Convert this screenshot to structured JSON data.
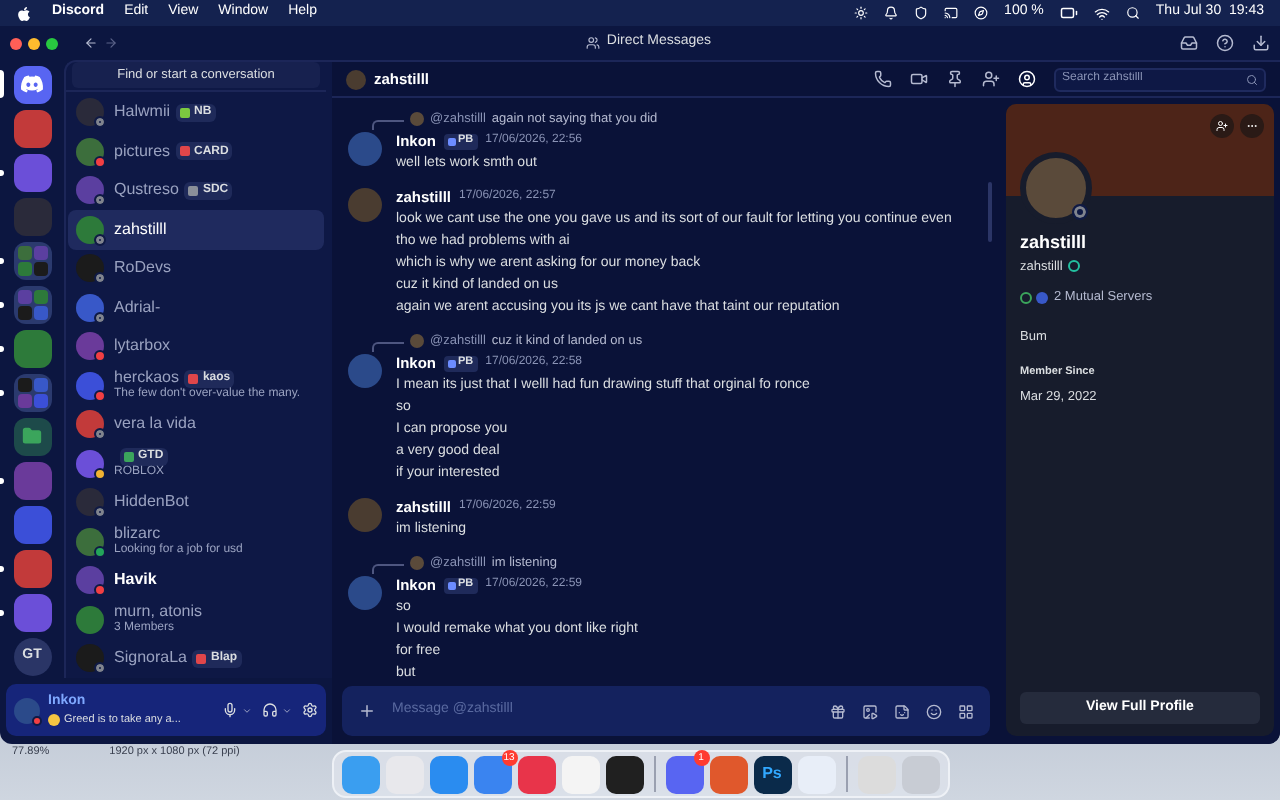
{
  "menu_bar": {
    "app": "Discord",
    "menus": [
      "Edit",
      "View",
      "Window",
      "Help"
    ],
    "battery": "100 %",
    "clock": "Thu Jul 30  19:43"
  },
  "window": {
    "title": "Direct Messages"
  },
  "servers": [
    {
      "kind": "home",
      "selected": true,
      "unread": false
    },
    {
      "kind": "image",
      "selected": false,
      "unread": false
    },
    {
      "kind": "image",
      "selected": false,
      "unread": true
    },
    {
      "kind": "image",
      "selected": false,
      "unread": false
    },
    {
      "kind": "folder",
      "selected": false,
      "unread": true
    },
    {
      "kind": "folder",
      "selected": false,
      "unread": true
    },
    {
      "kind": "image",
      "selected": false,
      "unread": true
    },
    {
      "kind": "folder",
      "selected": false,
      "unread": true
    },
    {
      "kind": "folder-open",
      "selected": false,
      "unread": false
    },
    {
      "kind": "image",
      "selected": false,
      "unread": true
    },
    {
      "kind": "image",
      "selected": false,
      "unread": false
    },
    {
      "kind": "image",
      "selected": false,
      "unread": true
    },
    {
      "kind": "image",
      "selected": false,
      "unread": true
    },
    {
      "kind": "text",
      "label": "GT",
      "selected": false,
      "unread": false
    }
  ],
  "dm_search": {
    "label": "Find or start a conversation"
  },
  "dms": [
    {
      "name": "Halwmii",
      "badge": {
        "text": "NB",
        "color": "#7cc940"
      },
      "status": {
        "color": "#80848e",
        "hollow": true
      },
      "selected": false,
      "unread": false
    },
    {
      "name": "pictures",
      "badge": {
        "text": "CARD",
        "color": "#e0464a"
      },
      "status": {
        "color": "#f23f43",
        "hollow": false
      },
      "selected": false,
      "unread": false
    },
    {
      "name": "Qustreso",
      "badge": {
        "text": "SDC",
        "color": "#8a8f99"
      },
      "status": {
        "color": "#80848e",
        "hollow": true
      },
      "selected": false,
      "unread": false
    },
    {
      "name": "zahstilll",
      "status": {
        "color": "#80848e",
        "hollow": true
      },
      "selected": true,
      "unread": false
    },
    {
      "name": "RoDevs",
      "status": {
        "color": "#80848e",
        "hollow": true
      },
      "selected": false,
      "unread": false
    },
    {
      "name": "Adrial-",
      "status": {
        "color": "#80848e",
        "hollow": true
      },
      "selected": false,
      "unread": false
    },
    {
      "name": "lytarbox",
      "status": {
        "color": "#f23f43",
        "hollow": false
      },
      "selected": false,
      "unread": false
    },
    {
      "name": "herckaos",
      "badge": {
        "text": "kaos",
        "color": "#e0464a"
      },
      "subtitle": "The few don't over-value the many.",
      "status": {
        "color": "#f23f43",
        "hollow": false
      },
      "selected": false,
      "unread": false
    },
    {
      "name": "vera la vida",
      "status": {
        "color": "#80848e",
        "hollow": true
      },
      "selected": false,
      "unread": false
    },
    {
      "badge": {
        "text": "GTD",
        "color": "#3ba55c"
      },
      "subtitle": "ROBLOX",
      "status": {
        "color": "#f0b232",
        "hollow": false
      },
      "selected": false,
      "unread": false
    },
    {
      "name": "HiddenBot",
      "status": {
        "color": "#80848e",
        "hollow": true
      },
      "selected": false,
      "unread": false
    },
    {
      "name": "blizarc",
      "subtitle": "Looking for a job for usd",
      "status": {
        "color": "#23a55a",
        "hollow": false
      },
      "selected": false,
      "unread": false
    },
    {
      "name": "Havik",
      "status": {
        "color": "#f23f43",
        "hollow": false
      },
      "selected": false,
      "unread": true
    },
    {
      "name": "murn, atonis",
      "subtitle": "3 Members",
      "selected": false,
      "unread": false
    },
    {
      "name": "SignoraLa",
      "badge": {
        "text": "Blap",
        "color": "#e0464a"
      },
      "status": {
        "color": "#80848e",
        "hollow": true
      },
      "selected": false,
      "unread": false
    }
  ],
  "user_panel": {
    "name": "Inkon",
    "status_text": "Greed is to take any a...",
    "status": {
      "color": "#f23f43",
      "hollow": false
    }
  },
  "chat": {
    "name": "zahstilll",
    "search_placeholder": "Search zahstilll",
    "input_placeholder": "Message @zahstilll",
    "messages": [
      {
        "reply": {
          "mention": "@zahstilll",
          "text": "again not saying that you did"
        },
        "author": "Inkon",
        "badge": "PB",
        "time": "17/06/2026, 22:56",
        "lines": [
          "well lets work smth out"
        ]
      },
      {
        "author": "zahstilll",
        "time": "17/06/2026, 22:57",
        "lines": [
          "look we cant use the one you gave us and its sort of our fault for letting you continue even tho we had problems with ai",
          "which is why we arent asking for our money back",
          "cuz it kind of landed on us",
          "again we arent accusing you its js we cant have that taint our reputation"
        ]
      },
      {
        "reply": {
          "mention": "@zahstilll",
          "text": "cuz it kind of landed on us"
        },
        "author": "Inkon",
        "badge": "PB",
        "time": "17/06/2026, 22:58",
        "lines": [
          "I mean its just that I welll had fun drawing stuff that orginal fo ronce",
          "so",
          "I can propose you",
          "a very good deal",
          "if your interested"
        ]
      },
      {
        "author": "zahstilll",
        "time": "17/06/2026, 22:59",
        "lines": [
          "im listening"
        ]
      },
      {
        "reply": {
          "mention": "@zahstilll",
          "text": "im listening"
        },
        "author": "Inkon",
        "badge": "PB",
        "time": "17/06/2026, 22:59",
        "lines": [
          "so",
          "I would remake what you dont like right",
          "for free",
          "but"
        ]
      }
    ]
  },
  "profile": {
    "display_name": "zahstilll",
    "username": "zahstilll",
    "status": {
      "color": "#80848e",
      "hollow": true
    },
    "mutual": "2 Mutual Servers",
    "bio": "Bum",
    "member_since_label": "Member Since",
    "member_since": "Mar 29, 2022",
    "button": "View Full Profile"
  },
  "desktop": {
    "zoom": "77.89%",
    "doc_size": "1920 px x 1080 px (72 ppi)",
    "dock": [
      {
        "kind": "finder"
      },
      {
        "kind": "launchpad"
      },
      {
        "kind": "safari"
      },
      {
        "kind": "mail",
        "badge": "13"
      },
      {
        "kind": "creative"
      },
      {
        "kind": "chatgpt"
      },
      {
        "kind": "roblox"
      },
      {
        "kind": "separator"
      },
      {
        "kind": "discord",
        "badge": "1"
      },
      {
        "kind": "claude"
      },
      {
        "kind": "photoshop",
        "label": "Ps"
      },
      {
        "kind": "quicktime"
      },
      {
        "kind": "separator"
      },
      {
        "kind": "document"
      },
      {
        "kind": "trash"
      }
    ]
  }
}
